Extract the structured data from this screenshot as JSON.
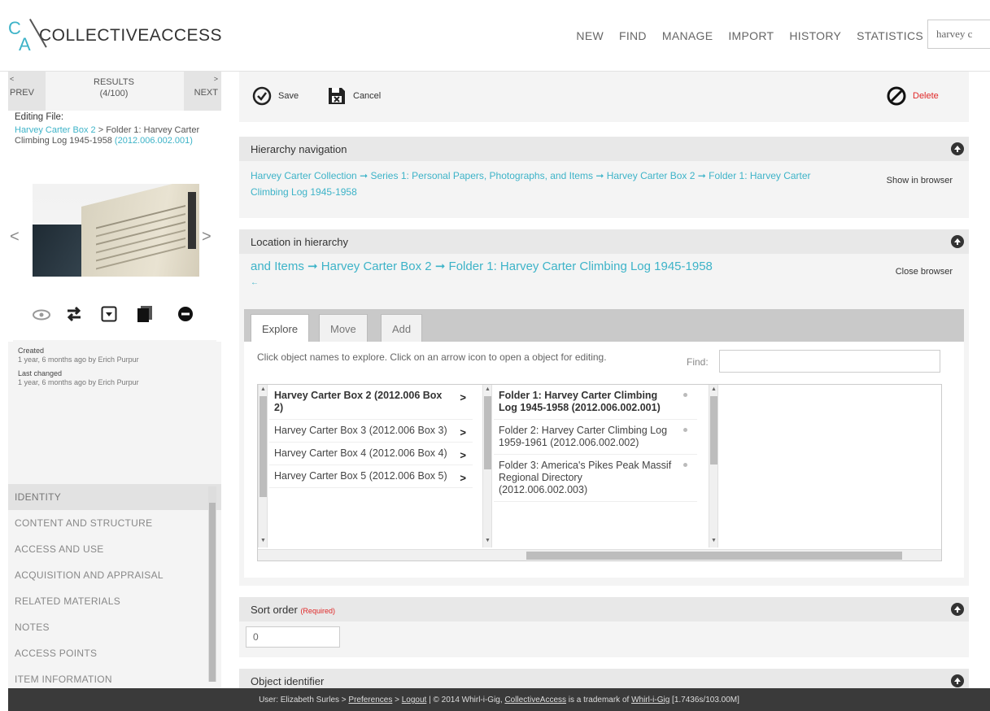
{
  "app": {
    "logo_text": "COLLECTIVEACCESS",
    "logo_letters": {
      "c": "C",
      "a": "A"
    }
  },
  "topnav": {
    "items": [
      "NEW",
      "FIND",
      "MANAGE",
      "IMPORT",
      "HISTORY",
      "STATISTICS"
    ],
    "search_value": "harvey c"
  },
  "sidebar": {
    "prev_label": "PREV",
    "prev_arrow": "<",
    "next_label": "NEXT",
    "next_arrow": ">",
    "results_label": "RESULTS",
    "results_count": "(4/100)",
    "editing_label": "Editing File:",
    "editing_path": {
      "link1": "Harvey Carter Box 2",
      "sep": " > Folder 1: Harvey Carter Climbing Log 1945-1958 ",
      "link2": "(2012.006.002.001)"
    },
    "thumb_prev": "<",
    "thumb_next": ">",
    "icons": [
      "eye-icon",
      "swap-icon",
      "dropdown-icon",
      "duplicate-icon",
      "remove-icon"
    ],
    "meta": {
      "created_label": "Created",
      "created_value": "1 year, 6 months ago by Erich Purpur",
      "changed_label": "Last changed",
      "changed_value": "1 year, 6 months ago by Erich Purpur"
    },
    "sections": [
      "IDENTITY",
      "CONTENT AND STRUCTURE",
      "ACCESS AND USE",
      "ACQUISITION AND APPRAISAL",
      "RELATED MATERIALS",
      "NOTES",
      "ACCESS POINTS",
      "ITEM INFORMATION"
    ]
  },
  "toolbar": {
    "save_label": "Save",
    "cancel_label": "Cancel",
    "delete_label": "Delete"
  },
  "hierarchy_nav": {
    "title": "Hierarchy navigation",
    "path": [
      "Harvey Carter Collection",
      "Series 1: Personal Papers, Photographs, and Items",
      "Harvey Carter Box 2",
      "Folder 1: Harvey Carter Climbing Log 1945-1958"
    ],
    "arrow": "➞",
    "show_browser": "Show in browser"
  },
  "location": {
    "title": "Location in hierarchy",
    "path": "and Items ➞ Harvey Carter Box 2 ➞ Folder 1: Harvey Carter Climbing Log 1945-1958",
    "back": "←",
    "close_browser": "Close browser",
    "tabs": [
      "Explore",
      "Move",
      "Add"
    ],
    "hint": "Click object names to explore. Click on an arrow icon to open a object for editing.",
    "find_label": "Find:",
    "left_column": [
      {
        "label": "Harvey Carter Box 2 (2012.006 Box 2)",
        "bold": true
      },
      {
        "label": "Harvey Carter Box 3 (2012.006 Box 3)",
        "bold": false
      },
      {
        "label": "Harvey Carter Box 4 (2012.006 Box 4)",
        "bold": false
      },
      {
        "label": "Harvey Carter Box 5 (2012.006 Box 5)",
        "bold": false
      }
    ],
    "right_column": [
      {
        "label": "Folder 1: Harvey Carter Climbing Log 1945-1958 (2012.006.002.001)",
        "bold": true
      },
      {
        "label": "Folder 2: Harvey Carter Climbing Log 1959-1961 (2012.006.002.002)",
        "bold": false
      },
      {
        "label": "Folder 3: America's Pikes Peak Massif Regional Directory (2012.006.002.003)",
        "bold": false
      }
    ],
    "go_arrow": ">"
  },
  "sort_order": {
    "title": "Sort order",
    "required": "(Required)",
    "value": "0"
  },
  "object_identifier": {
    "title": "Object identifier"
  },
  "footer": {
    "user_prefix": "User: Elizabeth Surles > ",
    "preferences": "Preferences",
    "sep1": " > ",
    "logout": "Logout",
    "mid": "  |  © 2014 Whirl-i-Gig, ",
    "ca_link": "CollectiveAccess",
    "mid2": " is a trademark of ",
    "wig_link": "Whirl-i-Gig",
    "stats": " [1.7436s/103.00M]"
  },
  "colors": {
    "accent": "#3db3c8",
    "danger": "#e02828",
    "footer_bg": "#3a3a3a"
  }
}
